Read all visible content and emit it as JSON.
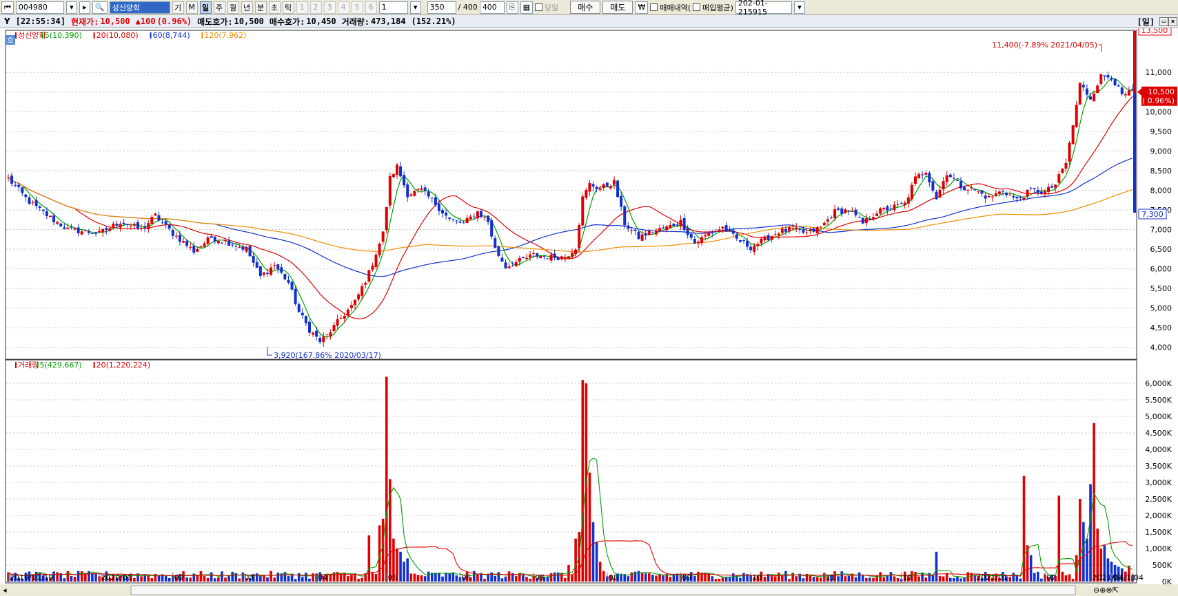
{
  "toolbar": {
    "code": "004980",
    "name": "성신양회",
    "periods": [
      "일",
      "주",
      "월",
      "년",
      "분",
      "초",
      "틱"
    ],
    "active_period": "일",
    "ki": "기",
    "m": "M",
    "nums": [
      "1",
      "2",
      "3",
      "4",
      "5",
      "6"
    ],
    "num_select": "1",
    "count_value": "350",
    "count_total": "/ 400",
    "count_box": "400",
    "dangil": "당일",
    "buy": "매수",
    "sell": "매도",
    "won": "₩",
    "trade_history": "매매내역(",
    "avg_price": "매입평균)",
    "account": "202-01-215915"
  },
  "infobar": {
    "time": "[22:55:34]",
    "current_label": "현재가:",
    "current_value": "10,500",
    "change": "▲100",
    "change_pct": "(0.96%)",
    "ask_label": "매도호가:",
    "ask_value": "10,500",
    "bid_label": "매수호가:",
    "bid_value": "10,450",
    "vol_label": "거래량:",
    "vol_value": "473,184",
    "vol_pct": "(152.21%)",
    "day_tag": "[일]"
  },
  "chart_data": [
    {
      "type": "candlestick",
      "title": "",
      "legend": [
        {
          "label": "성신양회",
          "color": "#e00000"
        },
        {
          "label": "5(10,390)",
          "color": "#00a000"
        },
        {
          "label": "20(10,080)",
          "color": "#e00000"
        },
        {
          "label": "60(8,744)",
          "color": "#1030d0"
        },
        {
          "label": "120(7,962)",
          "color": "#f08c00"
        }
      ],
      "x_start": "2019/11/19",
      "x_end": "2021/04/13",
      "x_ticks": [
        "2019/11/19",
        "2020/01",
        "02",
        "03",
        "04",
        "05",
        "06",
        "07",
        "08",
        "09",
        "10",
        "11",
        "12",
        "2021/01",
        "02",
        "03",
        "04",
        "2021/04/13"
      ],
      "ylim": [
        3750,
        11950
      ],
      "y_ticks": [
        "4,000",
        "4,500",
        "5,000",
        "5,500",
        "6,000",
        "6,500",
        "7,000",
        "7,500",
        "8,000",
        "8,500",
        "9,000",
        "9,500",
        "10,000",
        "10,500",
        "11,000"
      ],
      "price_path": [
        [
          0,
          8300
        ],
        [
          6,
          7700
        ],
        [
          12,
          7300
        ],
        [
          17,
          7000
        ],
        [
          26,
          6900
        ],
        [
          32,
          7200
        ],
        [
          38,
          7000
        ],
        [
          42,
          7350
        ],
        [
          47,
          6900
        ],
        [
          53,
          6450
        ],
        [
          58,
          6800
        ],
        [
          62,
          6700
        ],
        [
          68,
          6500
        ],
        [
          72,
          5800
        ],
        [
          76,
          6100
        ],
        [
          80,
          5650
        ],
        [
          83,
          4900
        ],
        [
          86,
          4450
        ],
        [
          89,
          4150
        ],
        [
          91,
          4300
        ],
        [
          95,
          4750
        ],
        [
          99,
          5150
        ],
        [
          103,
          5900
        ],
        [
          107,
          6900
        ],
        [
          109,
          8300
        ],
        [
          111,
          8600
        ],
        [
          114,
          7900
        ],
        [
          118,
          8000
        ],
        [
          122,
          7650
        ],
        [
          126,
          7250
        ],
        [
          130,
          7150
        ],
        [
          134,
          7450
        ],
        [
          137,
          7200
        ],
        [
          139,
          6500
        ],
        [
          142,
          6050
        ],
        [
          146,
          6200
        ],
        [
          150,
          6350
        ],
        [
          155,
          6300
        ],
        [
          159,
          6300
        ],
        [
          162,
          6550
        ],
        [
          164,
          7800
        ],
        [
          166,
          8150
        ],
        [
          169,
          8050
        ],
        [
          173,
          8200
        ],
        [
          176,
          7150
        ],
        [
          180,
          6800
        ],
        [
          184,
          6950
        ],
        [
          188,
          7050
        ],
        [
          192,
          7200
        ],
        [
          196,
          6650
        ],
        [
          200,
          6900
        ],
        [
          204,
          7050
        ],
        [
          208,
          6750
        ],
        [
          212,
          6550
        ],
        [
          216,
          6750
        ],
        [
          220,
          6950
        ],
        [
          224,
          7000
        ],
        [
          228,
          6900
        ],
        [
          232,
          7050
        ],
        [
          236,
          7450
        ],
        [
          240,
          7500
        ],
        [
          244,
          7150
        ],
        [
          248,
          7450
        ],
        [
          252,
          7550
        ],
        [
          256,
          7650
        ],
        [
          259,
          8300
        ],
        [
          262,
          8500
        ],
        [
          265,
          7800
        ],
        [
          268,
          8450
        ],
        [
          272,
          8100
        ],
        [
          276,
          8000
        ],
        [
          280,
          7800
        ],
        [
          284,
          8000
        ],
        [
          288,
          7750
        ],
        [
          292,
          8000
        ],
        [
          296,
          7950
        ],
        [
          299,
          8150
        ],
        [
          302,
          8700
        ],
        [
          304,
          9650
        ],
        [
          306,
          10700
        ],
        [
          309,
          10350
        ],
        [
          312,
          10900
        ],
        [
          315,
          10900
        ],
        [
          318,
          10400
        ],
        [
          321,
          10500
        ]
      ],
      "annotations": [
        {
          "text": "11,400(-7.89% 2021/04/05)",
          "kind": "high"
        },
        {
          "text": "3,920(167.86% 2020/03/17)",
          "kind": "low"
        }
      ],
      "current_price": "10,500",
      "current_change": "( 0.96%)",
      "range_max_label": "13,500",
      "range_min_label": "7,300"
    },
    {
      "type": "bar",
      "title": "",
      "legend": [
        {
          "label": "거래량",
          "color": "#e00000"
        },
        {
          "label": "5(429,667)",
          "color": "#00a000"
        },
        {
          "label": "20(1,220,224)",
          "color": "#e00000"
        }
      ],
      "ylim": [
        0,
        6500000
      ],
      "y_ticks": [
        "6,000K",
        "5,500K",
        "5,000K",
        "4,500K",
        "4,000K",
        "3,500K",
        "3,000K",
        "2,500K",
        "2,000K",
        "1,500K",
        "1,000K",
        "500K",
        "0K"
      ],
      "spikes": [
        [
          103,
          1400000
        ],
        [
          106,
          1700000
        ],
        [
          107,
          1900000
        ],
        [
          108,
          6200000
        ],
        [
          109,
          3100000
        ],
        [
          110,
          1300000
        ],
        [
          111,
          1000000
        ],
        [
          112,
          900000
        ],
        [
          113,
          600000
        ],
        [
          114,
          700000
        ],
        [
          160,
          500000
        ],
        [
          162,
          1300000
        ],
        [
          163,
          1500000
        ],
        [
          164,
          6100000
        ],
        [
          165,
          6000000
        ],
        [
          166,
          3300000
        ],
        [
          167,
          1800000
        ],
        [
          168,
          1200000
        ],
        [
          169,
          600000
        ],
        [
          265,
          900000
        ],
        [
          290,
          3200000
        ],
        [
          291,
          1100000
        ],
        [
          292,
          800000
        ],
        [
          300,
          2600000
        ],
        [
          305,
          800000
        ],
        [
          306,
          2500000
        ],
        [
          307,
          1800000
        ],
        [
          308,
          1300000
        ],
        [
          309,
          2950000
        ],
        [
          310,
          4800000
        ],
        [
          311,
          1600000
        ],
        [
          312,
          1000000
        ],
        [
          313,
          1100000
        ],
        [
          314,
          700000
        ],
        [
          315,
          600000
        ],
        [
          316,
          500000
        ],
        [
          317,
          450000
        ],
        [
          318,
          400000
        ],
        [
          319,
          300000
        ],
        [
          320,
          480000
        ]
      ]
    }
  ]
}
